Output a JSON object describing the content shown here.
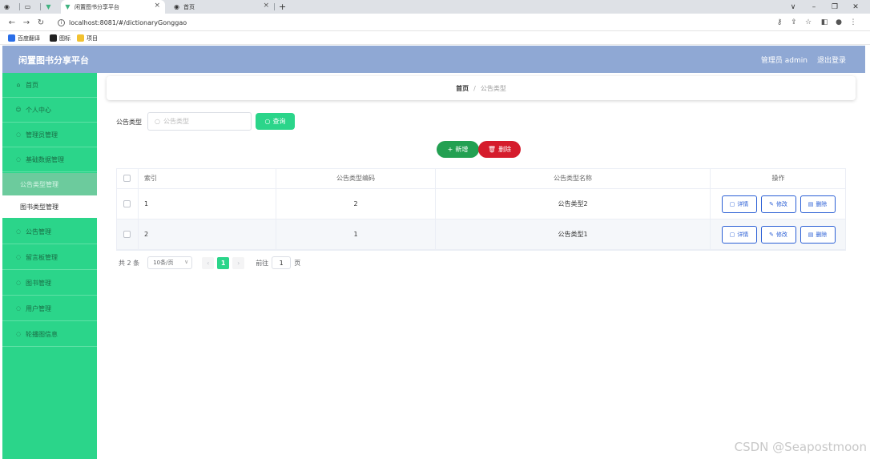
{
  "browser": {
    "tabs": [
      {
        "title": "闲置图书分享平台",
        "active": true
      },
      {
        "title": "首页",
        "active": false
      }
    ],
    "url": "localhost:8081/#/dictionaryGonggao",
    "bookmarks": [
      "百度翻译",
      "图标",
      "项目"
    ]
  },
  "header": {
    "title": "闲置图书分享平台",
    "user": "管理员 admin",
    "logout": "退出登录"
  },
  "sidebar": {
    "items": [
      {
        "label": "首页"
      },
      {
        "label": "个人中心"
      },
      {
        "label": "管理员管理"
      },
      {
        "label": "基础数据管理"
      }
    ],
    "sub_items": [
      {
        "label": "公告类型管理",
        "active": true
      },
      {
        "label": "图书类型管理",
        "active": false
      }
    ],
    "items_after": [
      {
        "label": "公告管理"
      },
      {
        "label": "留言板管理"
      },
      {
        "label": "图书管理"
      },
      {
        "label": "用户管理"
      },
      {
        "label": "轮播图信息"
      }
    ]
  },
  "breadcrumb": {
    "home": "首页",
    "separator": "/",
    "current": "公告类型"
  },
  "search": {
    "label": "公告类型",
    "placeholder": "公告类型",
    "button": "查询"
  },
  "actions": {
    "add": "新增",
    "delete": "删除"
  },
  "table": {
    "headers": {
      "index": "索引",
      "code": "公告类型编码",
      "name": "公告类型名称",
      "ops": "操作"
    },
    "rows": [
      {
        "index": "1",
        "code": "2",
        "name": "公告类型2"
      },
      {
        "index": "2",
        "code": "1",
        "name": "公告类型1"
      }
    ],
    "row_buttons": {
      "detail": "详情",
      "edit": "修改",
      "delete": "删除"
    }
  },
  "pagination": {
    "total": "共 2 条",
    "page_size": "10条/页",
    "current": "1",
    "goto_label": "前往",
    "goto_value": "1",
    "page_suffix": "页"
  },
  "watermark": "CSDN @Seapostmoon",
  "colors": {
    "sidebar": "#2bd58a",
    "header": "#8fa8d4",
    "add": "#23a052",
    "delete": "#d51c2c",
    "link": "#2b5fd5"
  }
}
